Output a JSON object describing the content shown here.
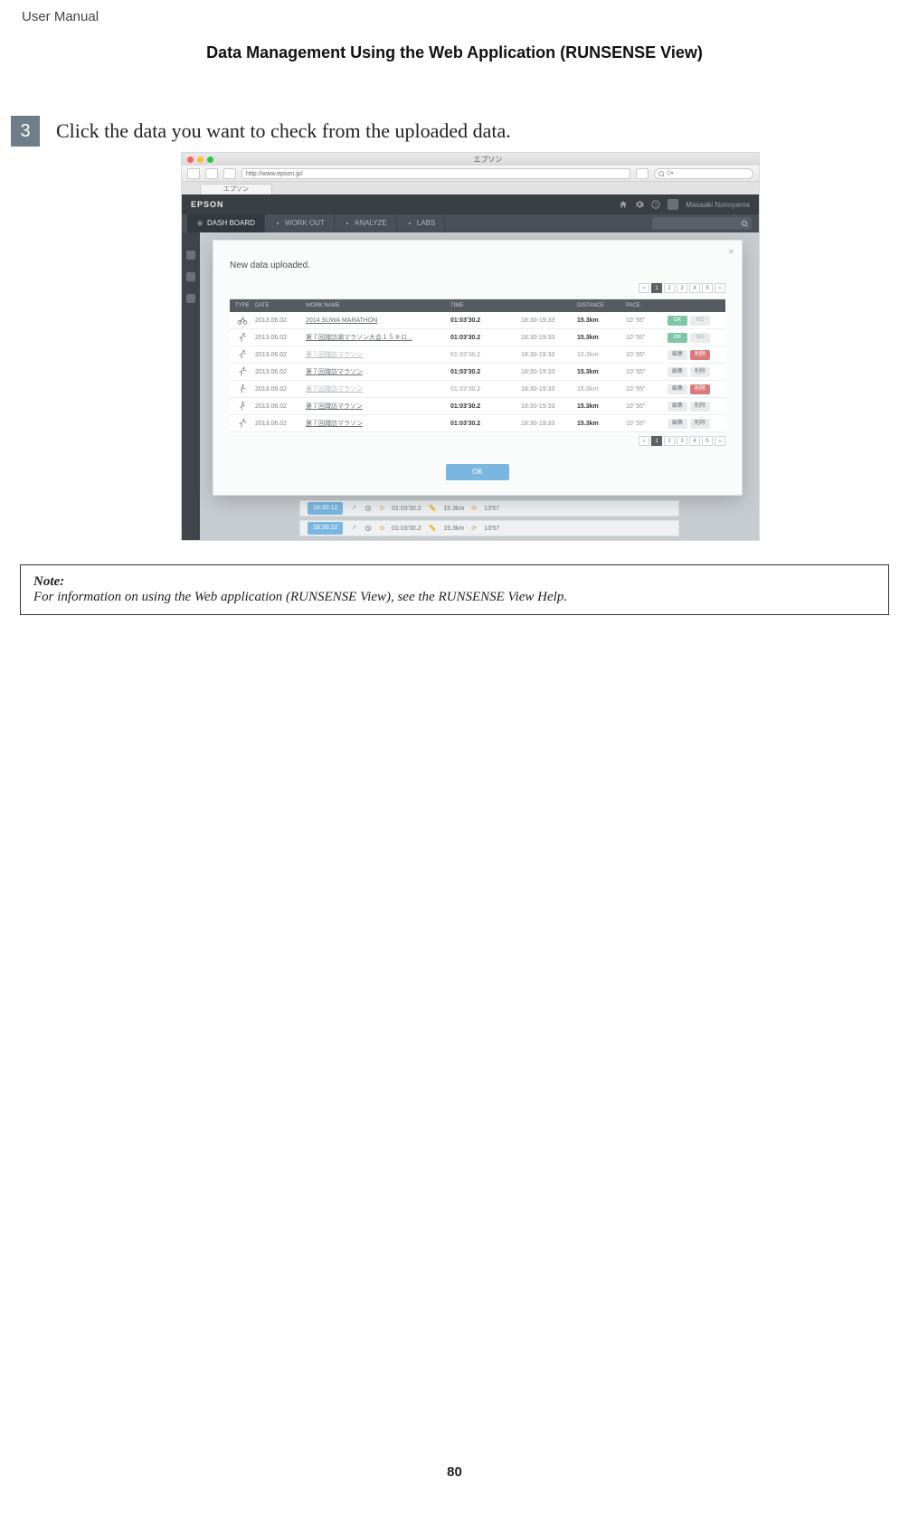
{
  "doc": {
    "running_head": "User Manual",
    "section_title": "Data Management Using the Web Application (RUNSENSE View)",
    "page_number": "80"
  },
  "step": {
    "number": "3",
    "text": "Click the data you want to check from the uploaded data."
  },
  "note": {
    "label": "Note:",
    "text": "For information on using the Web application (RUNSENSE View), see the RUNSENSE View Help."
  },
  "browser": {
    "window_title": "エプソン",
    "url": "http://www.epson.jp/",
    "tab_label": "エプソン",
    "search_placeholder": "Q▾"
  },
  "site": {
    "brand": "EPSON",
    "username": "Masaaki Nonoyama",
    "nav": {
      "dashboard": "DASH BOARD",
      "workout": "WORK OUT",
      "analyze": "ANALYZE",
      "labs": "LABS"
    }
  },
  "modal": {
    "title": "New data uploaded.",
    "pager": {
      "prev": "«",
      "pages": [
        "1",
        "2",
        "3",
        "4",
        "5"
      ],
      "next": "»",
      "current": "1"
    },
    "headers": {
      "type": "TYPE",
      "date": "DATE",
      "work_name": "WORK NAME",
      "time": "TIME",
      "distance": "DISTANCE",
      "pace": "PACE"
    },
    "btn_labels": {
      "ok": "OK",
      "no": "NO",
      "edit": "編集",
      "delete": "削除"
    },
    "rows": [
      {
        "sport": "bike",
        "date": "2013.06.02",
        "name": "2014 SUWA MARATHON",
        "time": "01:03'30.2",
        "clock": "18:30-19:33",
        "dist": "15.3km",
        "pace": "10' 55\"",
        "style": "okno",
        "dim": false
      },
      {
        "sport": "run",
        "date": "2013.06.02",
        "name": "第７回諏訪湖マラソン大会１５キロ...",
        "time": "01:03'30.2",
        "clock": "18:30-19:33",
        "dist": "15.3km",
        "pace": "10' 55\"",
        "style": "okno",
        "dim": false
      },
      {
        "sport": "run",
        "date": "2013.06.02",
        "name": "第７回諏訪マラソン",
        "time": "01:03'30.2",
        "clock": "18:30-19:33",
        "dist": "15.3km",
        "pace": "10' 55\"",
        "style": "editdel-del",
        "dim": true
      },
      {
        "sport": "run",
        "date": "2013.06.02",
        "name": "第７回諏訪マラソン",
        "time": "01:03'30.2",
        "clock": "18:30-19:33",
        "dist": "15.3km",
        "pace": "10' 55\"",
        "style": "editdel",
        "dim": false
      },
      {
        "sport": "walk",
        "date": "2013.06.02",
        "name": "第７回諏訪マラソン",
        "time": "01:03'30.2",
        "clock": "18:30-19:33",
        "dist": "15.3km",
        "pace": "10' 55\"",
        "style": "editdel-del",
        "dim": true
      },
      {
        "sport": "walk",
        "date": "2013.06.02",
        "name": "第７回諏訪マラソン",
        "time": "01:03'30.2",
        "clock": "18:30-19:33",
        "dist": "15.3km",
        "pace": "10' 55\"",
        "style": "editdel",
        "dim": false
      },
      {
        "sport": "run",
        "date": "2013.06.02",
        "name": "第７回諏訪マラソン",
        "time": "01:03'30.2",
        "clock": "18:30-19:33",
        "dist": "15.3km",
        "pace": "10' 55\"",
        "style": "editdel",
        "dim": false
      }
    ],
    "ok_button": "OK"
  },
  "behind": {
    "time_chip": "18:30:12",
    "duration": "01:03'30.2",
    "distance": "15.3km",
    "avg": "13'57"
  }
}
